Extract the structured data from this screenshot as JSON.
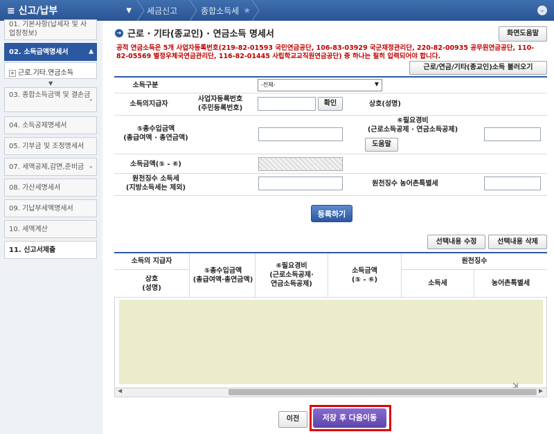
{
  "topbar": {
    "menu_label": "≡  신고/납부",
    "crumbs": [
      "세금신고",
      "종합소득세"
    ]
  },
  "sidebar": {
    "steps": [
      {
        "label": "01. 기본사항(납세자 및 사업장정보)"
      },
      {
        "label": "02. 소득금액명세서"
      },
      {
        "label": "03. 종합소득금액 및 결손금"
      },
      {
        "label": "04. 소득공제명세서"
      },
      {
        "label": "05. 기부금 및 조정명세서"
      },
      {
        "label": "07. 세액공제,감면,준비금"
      },
      {
        "label": "08. 가산세명세서"
      },
      {
        "label": "09. 기납부세액명세서"
      },
      {
        "label": "10. 세액계산"
      },
      {
        "label": "11. 신고서제출"
      }
    ],
    "sub_item": "근로.기타.연금소득"
  },
  "main": {
    "title": "근로 · 기타(종교인) · 연금소득 명세서",
    "help_button": "화면도움말",
    "notice": "공적 연금소득은 5개 사업자등록번호(219-82-01593 국민연금공단, 106-83-03929 국군재정관리단, 220-82-00935 공무원연금공단, 110-82-05569 별정우체국연금관리단, 116-82-01445 사립학교교직원연금공단) 중 하나는 필히 입력되어야 합니다.",
    "load_button": "근로/연금/기타(종교인)소득 불러오기"
  },
  "form": {
    "income_type_label": "소득구분",
    "income_type_value": "-전체-",
    "payer_label": "소득의지급자",
    "bizno_label": "사업자등록번호\n(주민등록번호)",
    "confirm_button": "확인",
    "company_label": "상호(성명)",
    "gross_label": "⑤총수입금액\n(총급여액 · 총연금액)",
    "expense_label": "⑥필요경비\n(근로소득공제 · 연금소득공제)",
    "expense_help_button": "도움말",
    "income_amount_label": "소득금액(⑤ - ⑥)",
    "withholding_label": "원천징수 소득세\n(지방소득세는 제외)",
    "rural_tax_label": "원천징수 농어촌특별세",
    "register_button": "등록하기"
  },
  "table": {
    "edit_button": "선택내용 수정",
    "delete_button": "선택내용 삭제",
    "headers": {
      "payer": "소득의 지급자",
      "company": "상호\n(성명)",
      "gross": "⑤총수입금액\n(총급여액·총연금액)",
      "expense": "⑥필요경비\n(근로소득공제·\n연금소득공제)",
      "income": "소득금액\n(⑤ - ⑥)",
      "withholding": "원천징수",
      "income_tax": "소득세",
      "rural_tax": "농어촌특별세"
    }
  },
  "footer": {
    "prev_button": "이전",
    "next_button": "저장 후 다음이동"
  }
}
